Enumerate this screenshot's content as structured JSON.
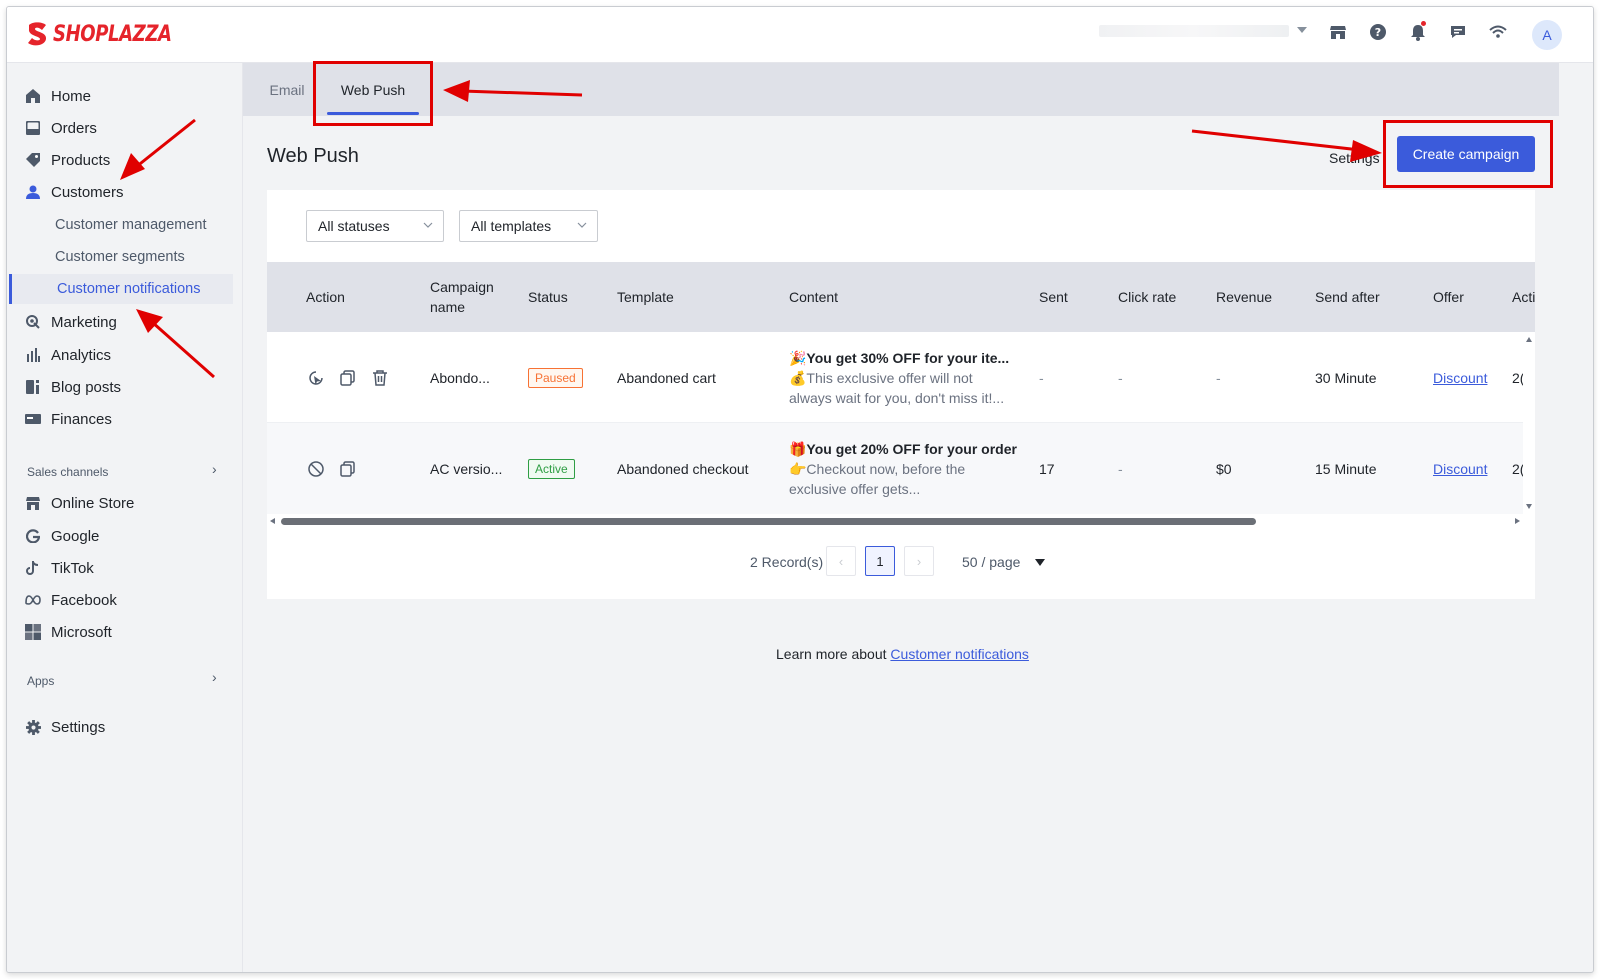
{
  "brand": {
    "name": "SHOPLAZZA",
    "color": "#e5242b"
  },
  "topbar": {
    "icons": [
      "store-icon",
      "help-icon",
      "bell-icon",
      "message-icon",
      "wifi-icon"
    ],
    "avatar_letter": "A"
  },
  "sidebar": {
    "items": [
      {
        "label": "Home",
        "icon": "home-icon"
      },
      {
        "label": "Orders",
        "icon": "orders-icon"
      },
      {
        "label": "Products",
        "icon": "tag-icon"
      },
      {
        "label": "Customers",
        "icon": "person-icon"
      },
      {
        "label": "Customer management"
      },
      {
        "label": "Customer segments"
      },
      {
        "label": "Customer notifications",
        "active": true
      },
      {
        "label": "Marketing",
        "icon": "marketing-icon"
      },
      {
        "label": "Analytics",
        "icon": "analytics-icon"
      },
      {
        "label": "Blog posts",
        "icon": "blog-icon"
      },
      {
        "label": "Finances",
        "icon": "finances-icon"
      }
    ],
    "sales_channels_label": "Sales channels",
    "channels": [
      {
        "label": "Online Store",
        "icon": "store-icon"
      },
      {
        "label": "Google",
        "icon": "google-icon"
      },
      {
        "label": "TikTok",
        "icon": "tiktok-icon"
      },
      {
        "label": "Facebook",
        "icon": "meta-icon"
      },
      {
        "label": "Microsoft",
        "icon": "microsoft-icon"
      }
    ],
    "apps_label": "Apps",
    "settings_label": "Settings"
  },
  "tabs": [
    {
      "label": "Email"
    },
    {
      "label": "Web Push",
      "active": true
    }
  ],
  "page": {
    "title": "Web Push",
    "settings_label": "Settings",
    "create_label": "Create campaign"
  },
  "filters": {
    "status": "All statuses",
    "template": "All templates"
  },
  "table": {
    "columns": [
      "Action",
      "Campaign\nname",
      "Status",
      "Template",
      "Content",
      "Sent",
      "Click rate",
      "Revenue",
      "Send after",
      "Offer",
      "Acti"
    ],
    "rows": [
      {
        "actions": [
          "resume-icon",
          "copy-icon",
          "delete-icon"
        ],
        "name": "Abondo...",
        "status": "Paused",
        "template": "Abandoned cart",
        "content_line1": "🎉You get 30% OFF for your ite...",
        "content_line2": "💰This exclusive offer will not",
        "content_line3": "always wait for you, don't miss it!...",
        "sent": "-",
        "click_rate": "-",
        "revenue": "-",
        "send_after": "30 Minute",
        "offer": "Discount",
        "extra": "2("
      },
      {
        "actions": [
          "disable-icon",
          "copy-icon"
        ],
        "name": "AC versio...",
        "status": "Active",
        "template": "Abandoned checkout",
        "content_line1": "🎁You get 20% OFF for your order",
        "content_line2": "👉Checkout now, before the",
        "content_line3": "exclusive offer gets...",
        "sent": "17",
        "click_rate": "-",
        "revenue": "$0",
        "send_after": "15 Minute",
        "offer": "Discount",
        "extra": "2("
      }
    ]
  },
  "pagination": {
    "records": "2 Record(s)",
    "current_page": "1",
    "per_page": "50 / page"
  },
  "footer": {
    "learn_prefix": "Learn more about",
    "learn_link": "Customer notifications"
  },
  "colors": {
    "accent": "#3b5bdb",
    "annotation": "#e00000"
  }
}
